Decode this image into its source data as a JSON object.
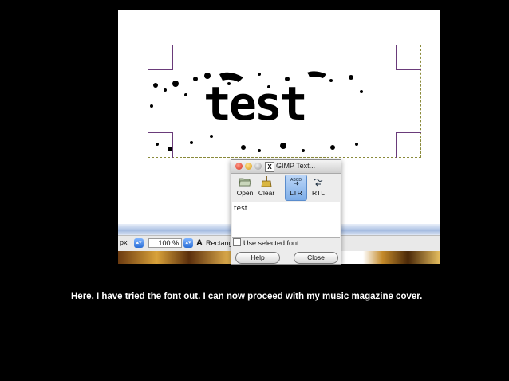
{
  "canvas": {
    "text": "test"
  },
  "statusbar": {
    "unit": "px",
    "zoom": "100 %",
    "tool_icon": "A",
    "tool": "Rectang"
  },
  "dialog": {
    "title": "GIMP Text...",
    "toolbar": {
      "open": "Open",
      "clear": "Clear",
      "ltr": "LTR",
      "rtl": "RTL"
    },
    "text_value": "test",
    "use_selected_font": "Use selected font",
    "help": "Help",
    "close": "Close"
  },
  "caption": "Here, I have tried the font out. I can now proceed with my music magazine cover.",
  "icons": [
    "folder-open-icon",
    "clear-broom-icon",
    "ltr-direction-icon",
    "rtl-direction-icon",
    "close-window-icon",
    "minimize-window-icon",
    "maximize-window-icon",
    "x11-icon",
    "text-tool-icon"
  ]
}
